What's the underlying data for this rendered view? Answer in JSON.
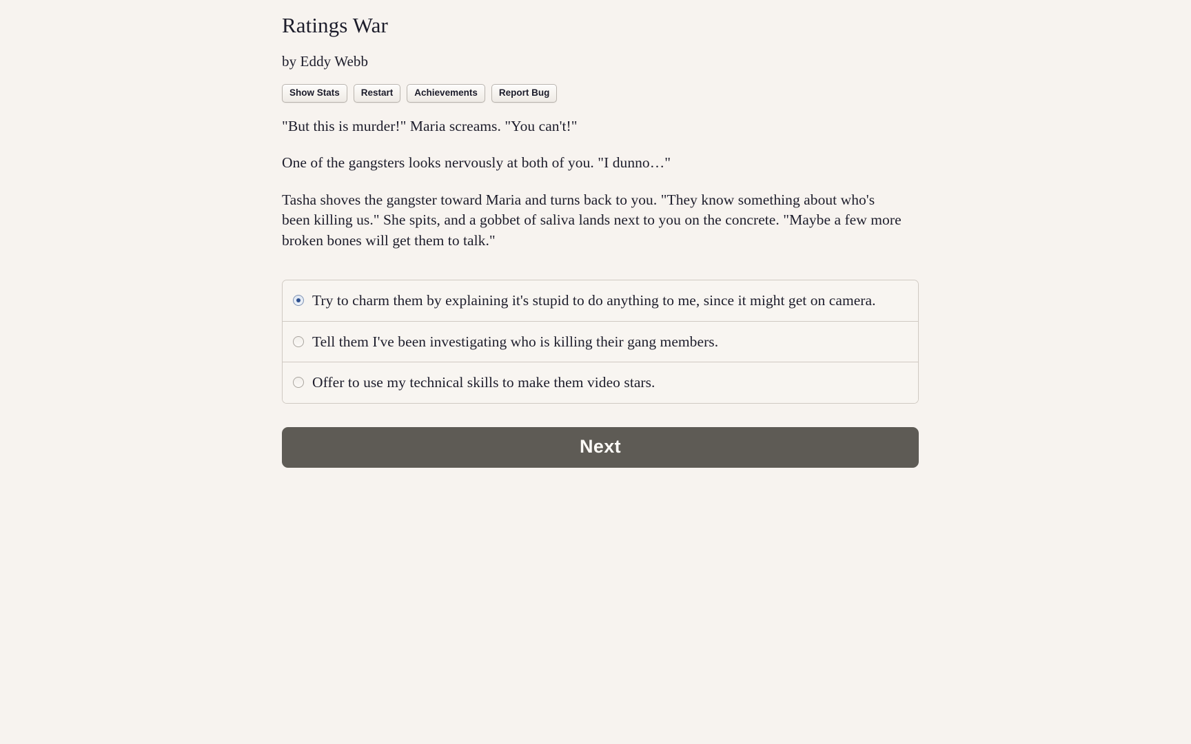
{
  "page": {
    "background_color": "#f7f3ef",
    "text_color": "#1d1d2b"
  },
  "header": {
    "title": "Ratings War",
    "byline": "by Eddy Webb"
  },
  "toolbar": {
    "buttons": [
      {
        "label": "Show Stats",
        "name": "show-stats-button"
      },
      {
        "label": "Restart",
        "name": "restart-button"
      },
      {
        "label": "Achievements",
        "name": "achievements-button"
      },
      {
        "label": "Report Bug",
        "name": "report-bug-button"
      }
    ]
  },
  "story": {
    "paragraphs": [
      "\"But this is murder!\" Maria screams. \"You can't!\"",
      "One of the gangsters looks nervously at both of you. \"I dunno…\"",
      "Tasha shoves the gangster toward Maria and turns back to you. \"They know something about who's been killing us.\" She spits, and a gobbet of saliva lands next to you on the concrete. \"Maybe a few more broken bones will get them to talk.\""
    ]
  },
  "choices": {
    "selected_index": 0,
    "options": [
      {
        "label": "Try to charm them by explaining it's stupid to do anything to me, since it might get on camera.",
        "selected": true
      },
      {
        "label": "Tell them I've been investigating who is killing their gang members.",
        "selected": false
      },
      {
        "label": "Offer to use my technical skills to make them video stars.",
        "selected": false
      }
    ]
  },
  "actions": {
    "next_label": "Next",
    "next_color": "#5e5b55"
  }
}
